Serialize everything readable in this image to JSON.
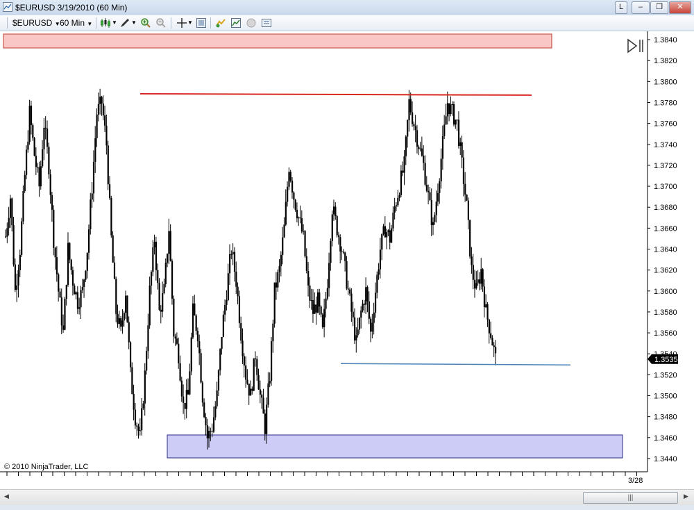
{
  "window": {
    "title": "$EURUSD  3/19/2010 (60 Min)",
    "buttons": [
      "L",
      "minimize",
      "restore",
      "close"
    ]
  },
  "toolbar": {
    "instrument": "$EURUSD",
    "interval": "60 Min",
    "icons": [
      "candlestick-style-icon",
      "draw-pencil-icon",
      "zoom-in-icon",
      "zoom-out-icon",
      "crosshair-icon",
      "data-box-icon",
      "strategies-icon",
      "indicators-icon",
      "properties-icon",
      "chart-trader-icon"
    ]
  },
  "copyright": "© 2010 NinjaTrader, LLC",
  "chart_data": {
    "type": "candlestick",
    "y_ticks": [
      "1.3840",
      "1.3820",
      "1.3800",
      "1.3780",
      "1.3760",
      "1.3740",
      "1.3720",
      "1.3700",
      "1.3680",
      "1.3660",
      "1.3640",
      "1.3620",
      "1.3600",
      "1.3580",
      "1.3560",
      "1.3540",
      "1.3520",
      "1.3500",
      "1.3480",
      "1.3460",
      "1.3440"
    ],
    "ylim": [
      1.3432,
      1.3848
    ],
    "x_label": "3/28",
    "last_price": "1.3535",
    "price_path": [
      [
        0,
        1.3652
      ],
      [
        3,
        1.369
      ],
      [
        6,
        1.36
      ],
      [
        9,
        1.364
      ],
      [
        12,
        1.371
      ],
      [
        15,
        1.377
      ],
      [
        18,
        1.373
      ],
      [
        21,
        1.37
      ],
      [
        24,
        1.376
      ],
      [
        27,
        1.372
      ],
      [
        30,
        1.365
      ],
      [
        33,
        1.36
      ],
      [
        36,
        1.356
      ],
      [
        39,
        1.364
      ],
      [
        42,
        1.361
      ],
      [
        45,
        1.359
      ],
      [
        48,
        1.36
      ],
      [
        51,
        1.364
      ],
      [
        54,
        1.37
      ],
      [
        57,
        1.377
      ],
      [
        60,
        1.378
      ],
      [
        63,
        1.374
      ],
      [
        66,
        1.365
      ],
      [
        69,
        1.358
      ],
      [
        72,
        1.356
      ],
      [
        75,
        1.36
      ],
      [
        78,
        1.352
      ],
      [
        81,
        1.348
      ],
      [
        84,
        1.346
      ],
      [
        87,
        1.352
      ],
      [
        90,
        1.36
      ],
      [
        93,
        1.365
      ],
      [
        96,
        1.358
      ],
      [
        99,
        1.36
      ],
      [
        102,
        1.366
      ],
      [
        105,
        1.356
      ],
      [
        108,
        1.354
      ],
      [
        111,
        1.349
      ],
      [
        114,
        1.35
      ],
      [
        117,
        1.358
      ],
      [
        120,
        1.356
      ],
      [
        123,
        1.35
      ],
      [
        126,
        1.346
      ],
      [
        129,
        1.347
      ],
      [
        132,
        1.35
      ],
      [
        135,
        1.356
      ],
      [
        138,
        1.36
      ],
      [
        141,
        1.364
      ],
      [
        144,
        1.361
      ],
      [
        147,
        1.356
      ],
      [
        150,
        1.352
      ],
      [
        153,
        1.35
      ],
      [
        156,
        1.354
      ],
      [
        159,
        1.35
      ],
      [
        162,
        1.347
      ],
      [
        165,
        1.352
      ],
      [
        168,
        1.36
      ],
      [
        171,
        1.362
      ],
      [
        174,
        1.366
      ],
      [
        177,
        1.372
      ],
      [
        180,
        1.369
      ],
      [
        183,
        1.367
      ],
      [
        186,
        1.365
      ],
      [
        189,
        1.36
      ],
      [
        192,
        1.358
      ],
      [
        195,
        1.359
      ],
      [
        198,
        1.356
      ],
      [
        201,
        1.361
      ],
      [
        204,
        1.368
      ],
      [
        207,
        1.366
      ],
      [
        210,
        1.364
      ],
      [
        213,
        1.361
      ],
      [
        216,
        1.358
      ],
      [
        219,
        1.355
      ],
      [
        222,
        1.358
      ],
      [
        225,
        1.36
      ],
      [
        228,
        1.356
      ],
      [
        231,
        1.36
      ],
      [
        234,
        1.364
      ],
      [
        237,
        1.366
      ],
      [
        240,
        1.365
      ],
      [
        243,
        1.368
      ],
      [
        246,
        1.37
      ],
      [
        249,
        1.372
      ],
      [
        252,
        1.378
      ],
      [
        255,
        1.376
      ],
      [
        258,
        1.374
      ],
      [
        261,
        1.372
      ],
      [
        264,
        1.369
      ],
      [
        267,
        1.366
      ],
      [
        270,
        1.37
      ],
      [
        273,
        1.374
      ],
      [
        276,
        1.378
      ],
      [
        279,
        1.377
      ],
      [
        282,
        1.376
      ],
      [
        285,
        1.372
      ],
      [
        288,
        1.368
      ],
      [
        291,
        1.362
      ],
      [
        294,
        1.36
      ],
      [
        297,
        1.362
      ],
      [
        300,
        1.358
      ],
      [
        303,
        1.356
      ],
      [
        306,
        1.3535
      ]
    ]
  },
  "annotations": {
    "resistance_line": "1.3787",
    "support_line": "1.3530",
    "top_zone": "1.3834 – 1.3848",
    "bottom_zone": "1.3437 – 1.3459"
  },
  "colors": {
    "top_zone_fill": "#f9c8c6",
    "top_zone_border": "#c0392b",
    "bottom_zone_fill": "#ccccf6",
    "bottom_zone_border": "#2a2a8a",
    "resistance": "#d8281f",
    "support": "#4a83b4",
    "candles": "#000000"
  }
}
